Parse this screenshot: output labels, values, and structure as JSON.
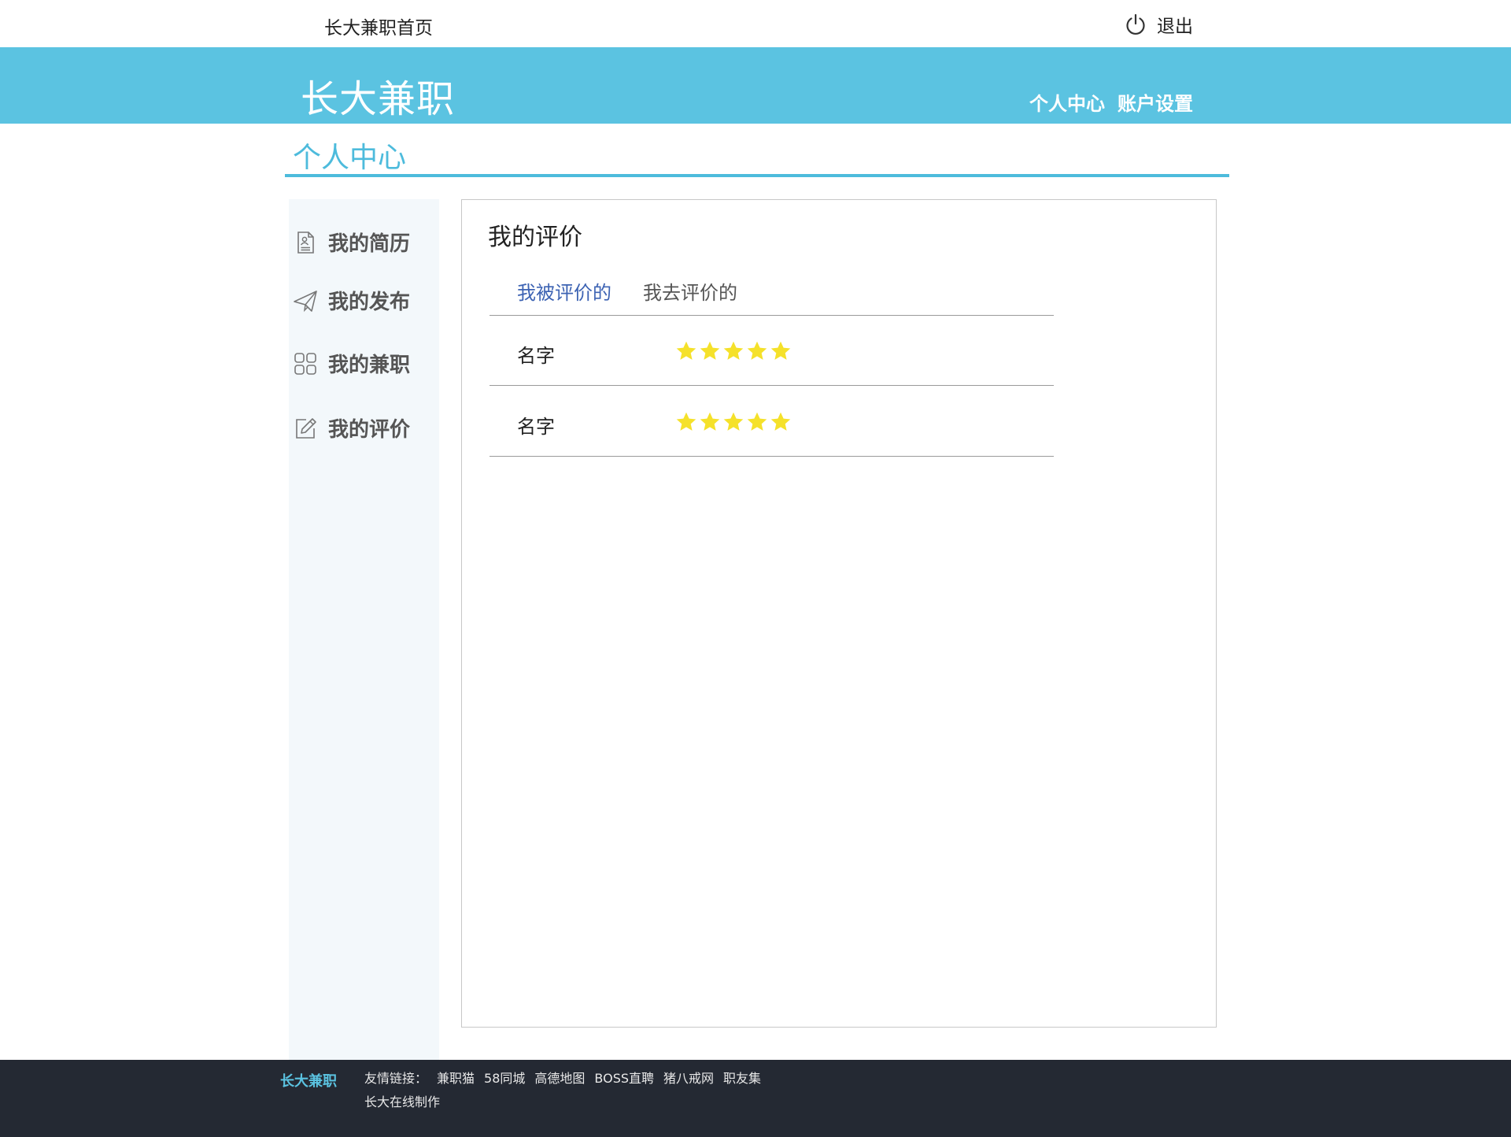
{
  "topbar": {
    "home_link": "长大兼职首页",
    "logout_label": "退出"
  },
  "header": {
    "brand": "长大兼职",
    "nav": [
      "个人中心",
      "账户设置"
    ]
  },
  "page_title": "个人中心",
  "sidebar": {
    "items": [
      {
        "label": "我的简历",
        "icon": "resume-icon"
      },
      {
        "label": "我的发布",
        "icon": "paper-plane-icon"
      },
      {
        "label": "我的兼职",
        "icon": "grid-icon"
      },
      {
        "label": "我的评价",
        "icon": "edit-icon"
      }
    ]
  },
  "panel": {
    "title": "我的评价",
    "tabs": [
      {
        "label": "我被评价的",
        "active": true
      },
      {
        "label": "我去评价的",
        "active": false
      }
    ],
    "reviews": [
      {
        "name": "名字",
        "rating": 5
      },
      {
        "name": "名字",
        "rating": 5
      }
    ]
  },
  "footer": {
    "brand": "长大兼职",
    "links_label": "友情链接：",
    "links": [
      "兼职猫",
      "58同城",
      "高德地图",
      "BOSS直聘",
      "猪八戒网",
      "职友集"
    ],
    "credit": "长大在线制作"
  },
  "colors": {
    "accent": "#5bc3e1",
    "star": "#f5e12a",
    "active_tab": "#3d63b3",
    "footer_bg": "#242933",
    "sidebar_bg": "#f3f8fb"
  }
}
